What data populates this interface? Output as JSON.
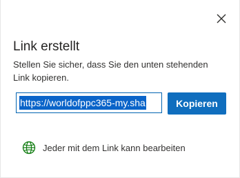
{
  "dialog": {
    "title": "Link erstellt",
    "description": "Stellen Sie sicher, dass Sie den unten stehenden Link kopieren.",
    "link_value": "https://worldofppc365-my.sha",
    "copy_label": "Kopieren",
    "permission_text": "Jeder mit dem Link kann bearbeiten",
    "close_icon": "close-icon",
    "permission_icon": "globe-icon"
  },
  "colors": {
    "accent": "#106ebe",
    "selection": "#0a64c9",
    "globe_green": "#107c10",
    "text": "#323130"
  }
}
